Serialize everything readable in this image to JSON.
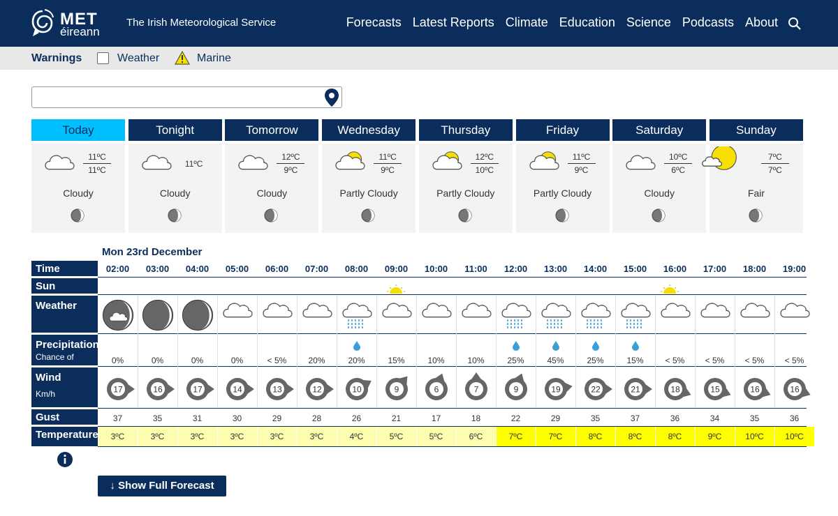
{
  "header": {
    "logo_top": "MET",
    "logo_bottom": "éireann",
    "tagline": "The Irish Meteorological Service",
    "nav": [
      "Forecasts",
      "Latest Reports",
      "Climate",
      "Education",
      "Science",
      "Podcasts",
      "About"
    ]
  },
  "warnings": {
    "title": "Warnings",
    "weather": "Weather",
    "marine": "Marine"
  },
  "location": {
    "value": ""
  },
  "days": [
    {
      "label": "Today",
      "hi": "11ºC",
      "lo": "11ºC",
      "desc": "Cloudy",
      "icon": "cloud",
      "active": true
    },
    {
      "label": "Tonight",
      "single": "11ºC",
      "desc": "Cloudy",
      "icon": "cloud"
    },
    {
      "label": "Tomorrow",
      "hi": "12ºC",
      "lo": "9ºC",
      "desc": "Cloudy",
      "icon": "cloud"
    },
    {
      "label": "Wednesday",
      "hi": "11ºC",
      "lo": "9ºC",
      "desc": "Partly Cloudy",
      "icon": "partly"
    },
    {
      "label": "Thursday",
      "hi": "12ºC",
      "lo": "10ºC",
      "desc": "Partly Cloudy",
      "icon": "partly"
    },
    {
      "label": "Friday",
      "hi": "11ºC",
      "lo": "9ºC",
      "desc": "Partly Cloudy",
      "icon": "partly"
    },
    {
      "label": "Saturday",
      "hi": "10ºC",
      "lo": "6ºC",
      "desc": "Cloudy",
      "icon": "cloud"
    },
    {
      "label": "Sunday",
      "hi": "7ºC",
      "lo": "7ºC",
      "desc": "Fair",
      "icon": "fair"
    }
  ],
  "hourly": {
    "date": "Mon 23rd December",
    "labels": {
      "time": "Time",
      "sun": "Sun",
      "weather": "Weather",
      "precip": "Precipitation",
      "precip_sub": "Chance of",
      "wind": "Wind",
      "wind_sub": "Km/h",
      "gust": "Gust",
      "temp": "Temperature"
    },
    "hours": [
      {
        "time": "02:00",
        "icon": "night-partly",
        "precip": "0%",
        "rain": false,
        "wind": "17",
        "dir": 90,
        "gust": "37",
        "temp": "3ºC",
        "tlevel": "light"
      },
      {
        "time": "03:00",
        "icon": "night",
        "precip": "0%",
        "rain": false,
        "wind": "16",
        "dir": 90,
        "gust": "35",
        "temp": "3ºC",
        "tlevel": "light"
      },
      {
        "time": "04:00",
        "icon": "night",
        "precip": "0%",
        "rain": false,
        "wind": "17",
        "dir": 90,
        "gust": "31",
        "temp": "3ºC",
        "tlevel": "light"
      },
      {
        "time": "05:00",
        "icon": "cloud",
        "precip": "0%",
        "rain": false,
        "wind": "14",
        "dir": 90,
        "gust": "30",
        "temp": "3ºC",
        "tlevel": "light"
      },
      {
        "time": "06:00",
        "icon": "cloud",
        "precip": "< 5%",
        "rain": false,
        "wind": "13",
        "dir": 90,
        "gust": "29",
        "temp": "3ºC",
        "tlevel": "light"
      },
      {
        "time": "07:00",
        "icon": "cloud",
        "precip": "20%",
        "rain": false,
        "wind": "12",
        "dir": 90,
        "gust": "28",
        "temp": "3ºC",
        "tlevel": "light"
      },
      {
        "time": "08:00",
        "icon": "rain",
        "precip": "20%",
        "rain": true,
        "wind": "10",
        "dir": 60,
        "gust": "26",
        "temp": "4ºC",
        "tlevel": "light"
      },
      {
        "time": "09:00",
        "icon": "cloud",
        "precip": "15%",
        "rain": false,
        "wind": "9",
        "dir": 40,
        "gust": "21",
        "temp": "5ºC",
        "tlevel": "light"
      },
      {
        "time": "10:00",
        "icon": "cloud",
        "precip": "10%",
        "rain": false,
        "wind": "6",
        "dir": 20,
        "gust": "17",
        "temp": "5ºC",
        "tlevel": "light"
      },
      {
        "time": "11:00",
        "icon": "cloud",
        "precip": "10%",
        "rain": false,
        "wind": "7",
        "dir": 0,
        "gust": "18",
        "temp": "6ºC",
        "tlevel": "light"
      },
      {
        "time": "12:00",
        "icon": "rain",
        "precip": "25%",
        "rain": true,
        "wind": "9",
        "dir": 20,
        "gust": "22",
        "temp": "7ºC",
        "tlevel": "bright"
      },
      {
        "time": "13:00",
        "icon": "rain",
        "precip": "45%",
        "rain": true,
        "wind": "19",
        "dir": 80,
        "gust": "29",
        "temp": "7ºC",
        "tlevel": "bright"
      },
      {
        "time": "14:00",
        "icon": "rain",
        "precip": "25%",
        "rain": true,
        "wind": "22",
        "dir": 90,
        "gust": "35",
        "temp": "8ºC",
        "tlevel": "bright"
      },
      {
        "time": "15:00",
        "icon": "rain",
        "precip": "15%",
        "rain": true,
        "wind": "21",
        "dir": 90,
        "gust": "37",
        "temp": "8ºC",
        "tlevel": "bright"
      },
      {
        "time": "16:00",
        "icon": "cloud",
        "precip": "< 5%",
        "rain": false,
        "wind": "18",
        "dir": 110,
        "gust": "36",
        "temp": "8ºC",
        "tlevel": "bright"
      },
      {
        "time": "17:00",
        "icon": "cloud",
        "precip": "< 5%",
        "rain": false,
        "wind": "15",
        "dir": 110,
        "gust": "34",
        "temp": "9ºC",
        "tlevel": "bright"
      },
      {
        "time": "18:00",
        "icon": "cloud",
        "precip": "< 5%",
        "rain": false,
        "wind": "16",
        "dir": 110,
        "gust": "35",
        "temp": "10ºC",
        "tlevel": "bright"
      },
      {
        "time": "19:00",
        "icon": "cloud",
        "precip": "< 5%",
        "rain": false,
        "wind": "16",
        "dir": 110,
        "gust": "36",
        "temp": "10ºC",
        "tlevel": "bright"
      }
    ]
  },
  "show_full": "↓ Show Full Forecast",
  "colors": {
    "navy": "#0a2d5c",
    "active_tab": "#00bfff",
    "temp_light": "#fdfdb0",
    "temp_bright": "#ffff00",
    "rain": "#3a9fd8",
    "sun": "#f7e000"
  }
}
